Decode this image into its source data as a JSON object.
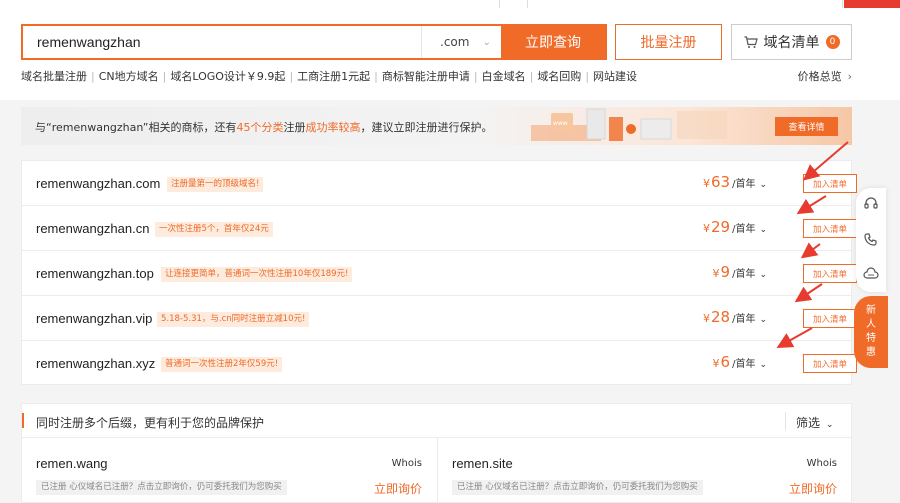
{
  "search": {
    "query": "remenwangzhan",
    "tld": ".com",
    "query_label": "立即查询"
  },
  "header": {
    "bulk_label": "批量注册",
    "cart_label": "域名清单",
    "cart_count": "0"
  },
  "quicklinks": [
    "域名批量注册",
    "CN地方域名",
    "域名LOGO设计￥9.9起",
    "工商注册1元起",
    "商标智能注册申请",
    "白金域名",
    "域名回购",
    "网站建设"
  ],
  "price_overview": "价格总览",
  "banner": {
    "text_pre": "与“remenwangzhan”相关的商标，还有",
    "text_hl1": "45个分类",
    "text_mid": "注册",
    "text_hl2": "成功率较高",
    "text_post": "，建议立即注册进行保护。",
    "button": "查看详情"
  },
  "results": [
    {
      "domain": "remenwangzhan.com",
      "tag": "注册量第一的顶级域名!",
      "yen": "¥",
      "price": "63",
      "unit": "/首年",
      "add": "加入清单"
    },
    {
      "domain": "remenwangzhan.cn",
      "tag": "一次性注册5个，首年仅24元",
      "yen": "¥",
      "price": "29",
      "unit": "/首年",
      "add": "加入清单"
    },
    {
      "domain": "remenwangzhan.top",
      "tag": "让连接更简单，普通词一次性注册10年仅189元!",
      "yen": "¥",
      "price": "9",
      "unit": "/首年",
      "add": "加入清单"
    },
    {
      "domain": "remenwangzhan.vip",
      "tag": "5.18-5.31，与.cn同时注册立减10元!",
      "yen": "¥",
      "price": "28",
      "unit": "/首年",
      "add": "加入清单"
    },
    {
      "domain": "remenwangzhan.xyz",
      "tag": "普通词一次性注册2年仅59元!",
      "yen": "¥",
      "price": "6",
      "unit": "/首年",
      "add": "加入清单"
    }
  ],
  "sidebar": {
    "promo": [
      "新",
      "人",
      "特",
      "惠"
    ]
  },
  "multi": {
    "title": "同时注册多个后缀，更有利于您的品牌保护",
    "filter": "筛选",
    "cards": [
      {
        "domain": "remen.wang",
        "whois": "Whois",
        "note": "已注册 心仪域名已注册？点击立即询价，仍可委托我们为您购买",
        "inquiry": "立即询价"
      },
      {
        "domain": "remen.site",
        "whois": "Whois",
        "note": "已注册 心仪域名已注册？点击立即询价，仍可委托我们为您购买",
        "inquiry": "立即询价"
      }
    ]
  },
  "colors": {
    "accent": "#f06a28",
    "tag_bg": "#fdebdd",
    "annotation_arrow": "#e63b2e"
  },
  "icons": {
    "tld_chevron": "chevron-down-icon",
    "cart": "cart-icon",
    "price_chevron": "chevron-right-icon",
    "sidebar": [
      "headset-icon",
      "phone-icon",
      "cloud-chat-icon"
    ]
  }
}
